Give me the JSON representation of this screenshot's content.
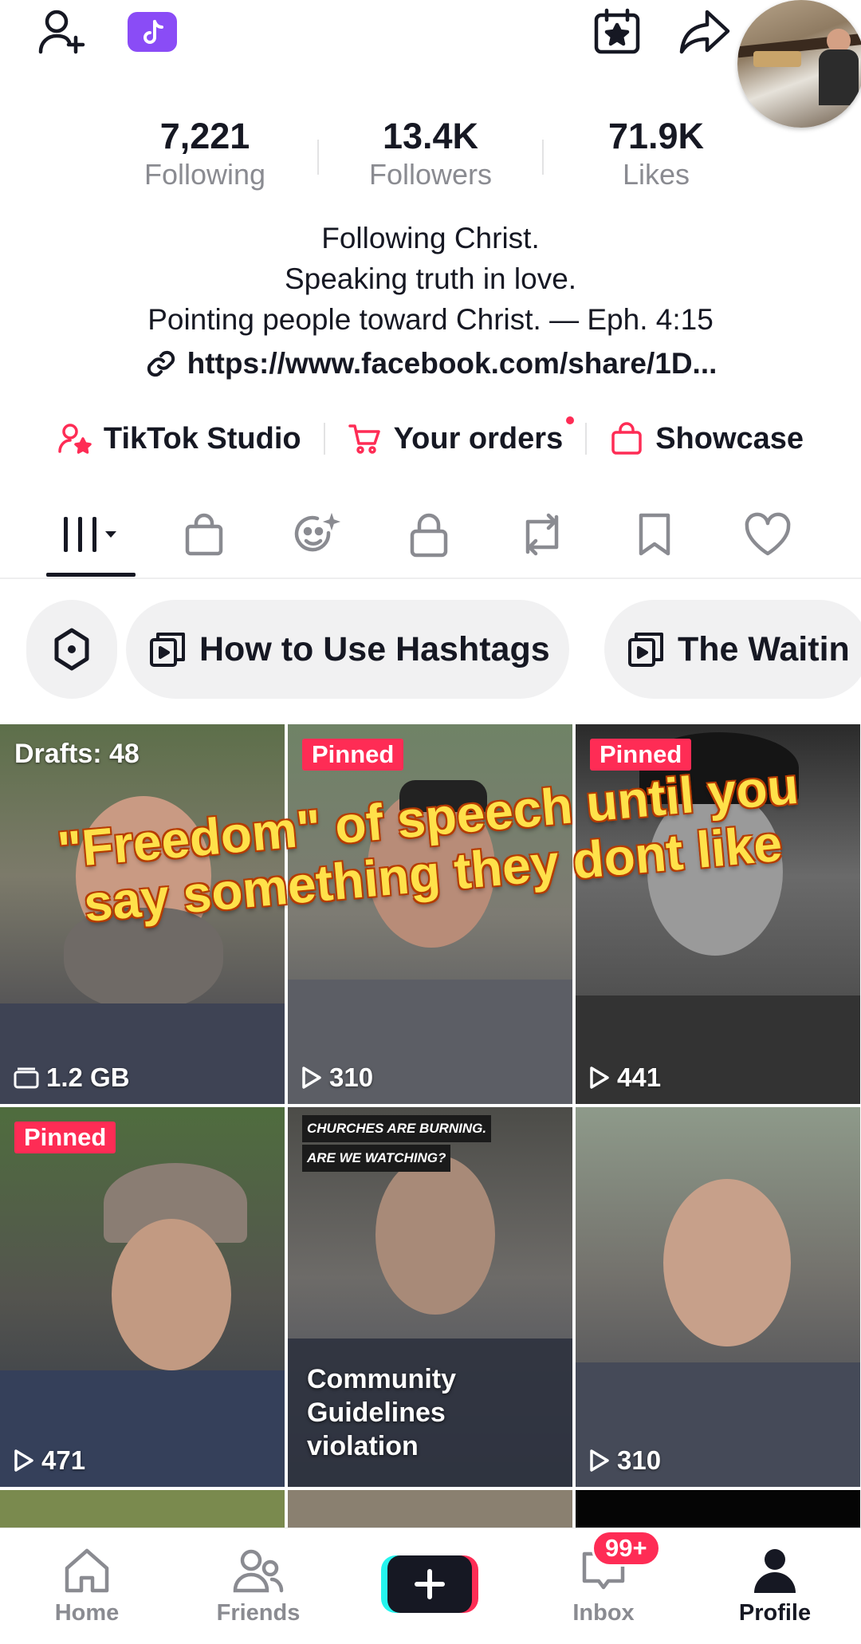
{
  "profile": {
    "stats": [
      {
        "value": "7,221",
        "label": "Following"
      },
      {
        "value": "13.4K",
        "label": "Followers"
      },
      {
        "value": "71.9K",
        "label": "Likes"
      }
    ],
    "bio": [
      "Following Christ.",
      "Speaking truth in love.",
      "Pointing people toward Christ. — Eph. 4:15"
    ],
    "link": "https://www.facebook.com/share/1D..."
  },
  "quick_actions": {
    "studio": "TikTok Studio",
    "orders": "Your orders",
    "showcase": "Showcase"
  },
  "tabs": [
    "videos-grid",
    "shop",
    "ai-self",
    "private",
    "reposts",
    "favorites",
    "liked"
  ],
  "chips": [
    "How to Use Hashtags",
    "The Waitin"
  ],
  "overlay_caption": "\"Freedom\" of speech until you say something they dont like",
  "grid": {
    "tiles": [
      {
        "top_label": "Drafts: 48",
        "count": "1.2 GB",
        "kind": "drafts"
      },
      {
        "top_label": "Pinned",
        "count": "310",
        "kind": "video"
      },
      {
        "top_label": "Pinned",
        "count": "441",
        "kind": "video"
      },
      {
        "top_label": "Pinned",
        "count": "471",
        "kind": "video"
      },
      {
        "top_text": [
          "CHURCHES ARE BURNING.",
          "ARE WE WATCHING?"
        ],
        "caption": "Community Guidelines violation",
        "kind": "violation"
      },
      {
        "count": "310",
        "kind": "video"
      }
    ]
  },
  "nav": {
    "home": "Home",
    "friends": "Friends",
    "inbox": "Inbox",
    "inbox_badge": "99+",
    "profile": "Profile"
  },
  "colors": {
    "accent": "#fe2c55",
    "text": "#161823",
    "muted": "#8a8b91",
    "chip_bg": "#f1f1f2",
    "overlay_yellow": "#ffe14a"
  }
}
